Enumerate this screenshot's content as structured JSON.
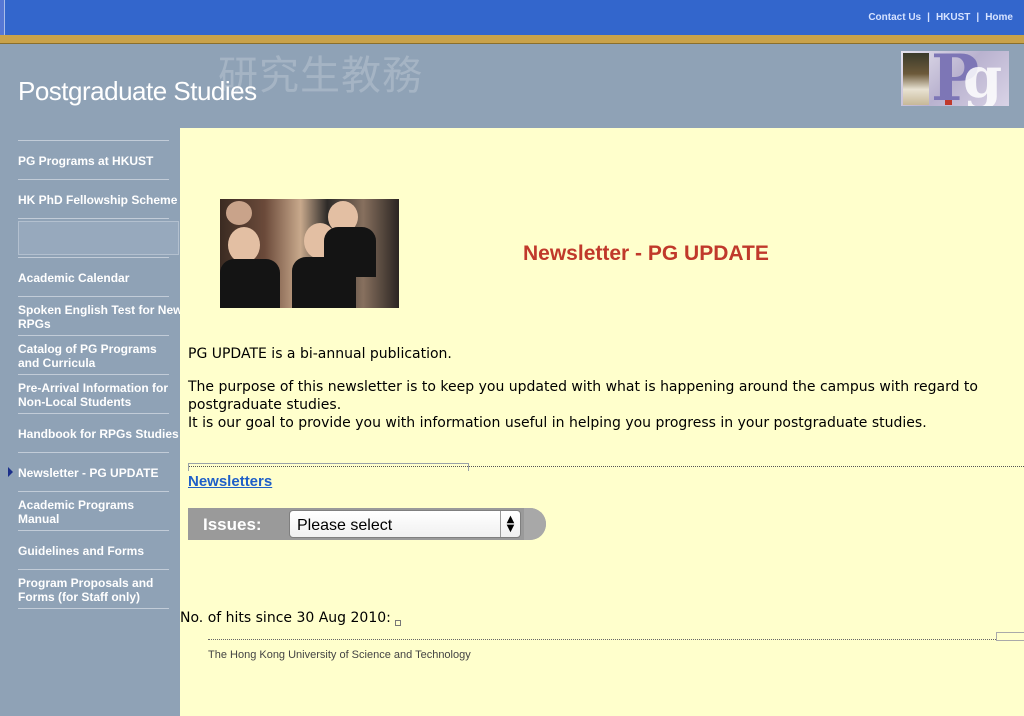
{
  "header": {
    "links": [
      "Contact Us",
      "HKUST",
      "Home"
    ],
    "site_title": "Postgraduate Studies",
    "cjk_title": "研究生教務",
    "logo_text": {
      "p": "P",
      "g": "g"
    }
  },
  "sidebar": {
    "items": [
      {
        "label": "PG Programs at HKUST"
      },
      {
        "label": "HK PhD Fellowship Scheme"
      },
      {
        "label": "Academic Calendar"
      },
      {
        "label": "Spoken English Test for New RPGs",
        "lines": [
          "Spoken English Test for New",
          "RPGs"
        ]
      },
      {
        "label": "Catalog of PG Programs and Curricula",
        "lines": [
          "Catalog of PG Programs",
          "and Curricula"
        ]
      },
      {
        "label": "Pre-Arrival Information for Non-Local Students",
        "lines": [
          "Pre-Arrival Information for",
          "Non-Local Students"
        ]
      },
      {
        "label": "Handbook for RPGs Studies"
      },
      {
        "label": "Newsletter - PG UPDATE",
        "active": true
      },
      {
        "label": "Academic Programs Manual",
        "lines": [
          "Academic Programs",
          "Manual"
        ]
      },
      {
        "label": "Guidelines and Forms"
      },
      {
        "label": "Program Proposals and Forms (for Staff only)",
        "lines": [
          "Program Proposals and",
          "Forms (for Staff only)"
        ]
      }
    ]
  },
  "main": {
    "headline": "Newsletter - PG UPDATE",
    "intro": "PG UPDATE is a bi-annual publication.",
    "purpose_line1": "The purpose of this newsletter is to keep you updated with what is happening around the campus with regard to",
    "purpose_line2": "postgraduate studies.",
    "goal": "It is our goal to provide you with information useful in helping you progress in your postgraduate studies.",
    "newsletters_link": "Newsletters",
    "issues_label": "Issues:",
    "issues_selected": "Please select",
    "hits_text": "No. of hits since 30 Aug 2010:",
    "footer": "The Hong Kong University of Science and Technology"
  },
  "colors": {
    "topbar": "#3366cc",
    "gold": "#c9a24a",
    "banner": "#8fa2b6",
    "content_bg": "#ffffcc",
    "headline": "#c0392b",
    "link": "#1f5fc8"
  }
}
